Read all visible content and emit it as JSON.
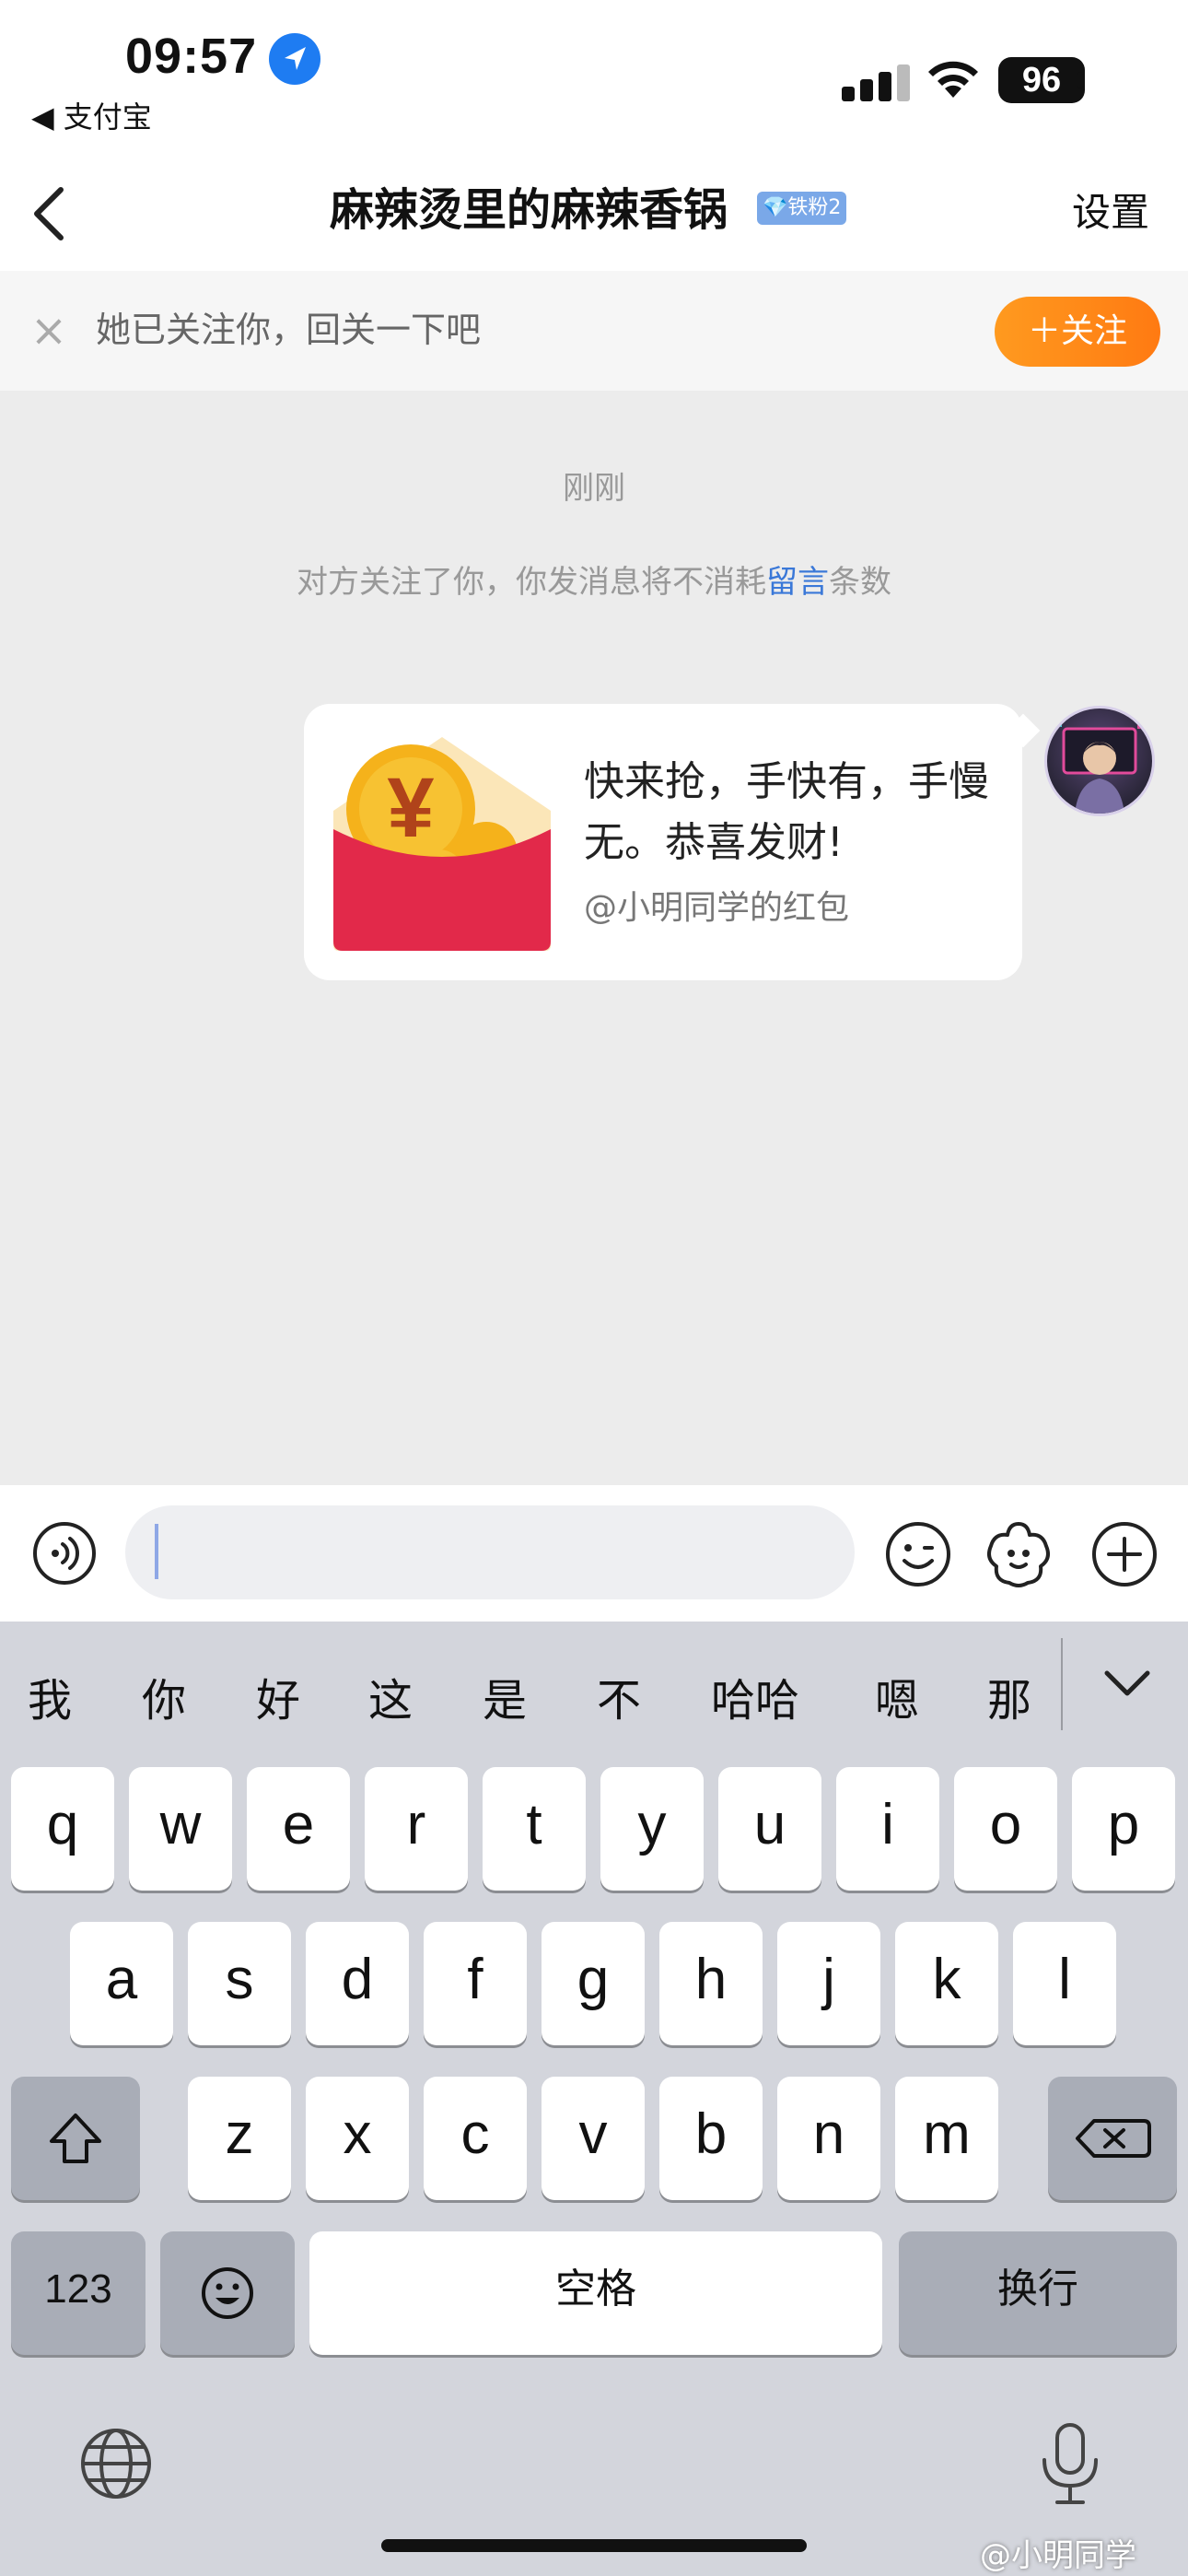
{
  "status_bar": {
    "time": "09:57",
    "back_app": "◀ 支付宝",
    "battery": "96"
  },
  "nav": {
    "title": "麻辣烫里的麻辣香锅",
    "fan_badge": "💎铁粉2",
    "settings": "设置"
  },
  "follow_banner": {
    "text": "她已关注你，回关一下吧",
    "button": "＋关注"
  },
  "chat": {
    "timestamp": "刚刚",
    "system_msg_before": "对方关注了你，你发消息将不消耗",
    "system_msg_link": "留言",
    "system_msg_after": "条数",
    "message": {
      "text": "快来抢，手快有，手慢无。恭喜发财!",
      "sub": "@小明同学的红包"
    }
  },
  "input": {
    "value": "",
    "placeholder": ""
  },
  "keyboard": {
    "candidates": [
      "我",
      "你",
      "好",
      "这",
      "是",
      "不",
      "哈哈",
      "嗯",
      "那"
    ],
    "row1": [
      "q",
      "w",
      "e",
      "r",
      "t",
      "y",
      "u",
      "i",
      "o",
      "p"
    ],
    "row2": [
      "a",
      "s",
      "d",
      "f",
      "g",
      "h",
      "j",
      "k",
      "l"
    ],
    "row3": [
      "z",
      "x",
      "c",
      "v",
      "b",
      "n",
      "m"
    ],
    "numbers_label": "123",
    "space_label": "空格",
    "return_label": "换行"
  },
  "watermark": "@小明同学",
  "colors": {
    "accent_orange": "#ff8a18",
    "link_blue": "#3a78d8",
    "redpacket_red": "#e2294a",
    "coin_gold": "#f5b21b"
  }
}
